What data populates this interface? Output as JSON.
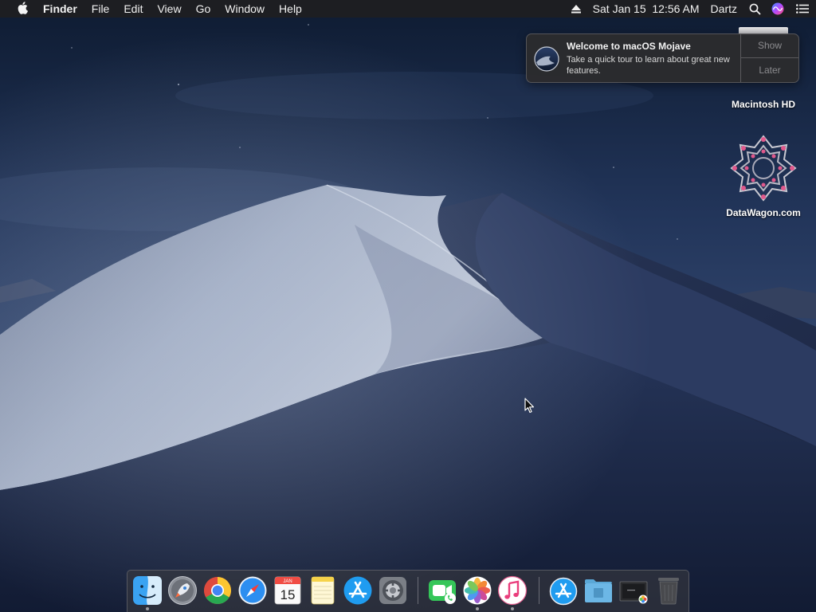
{
  "menubar": {
    "apple_icon": "apple-logo-icon",
    "app_name": "Finder",
    "menus": [
      "File",
      "Edit",
      "View",
      "Go",
      "Window",
      "Help"
    ],
    "status": {
      "eject_icon": "eject-icon",
      "clock": "Sat Jan 15  12:56 AM",
      "user": "Dartz",
      "spotlight_icon": "search-icon",
      "siri_icon": "siri-icon",
      "notification_center_icon": "list-icon"
    }
  },
  "notification": {
    "title": "Welcome to macOS Mojave",
    "body": "Take a quick tour to learn about great new features.",
    "show_label": "Show",
    "later_label": "Later"
  },
  "desktop_icons": [
    {
      "label": "Macintosh HD",
      "icon": "hard-drive-icon"
    },
    {
      "label": "DataWagon.com",
      "icon": "datawagon-logo-icon"
    }
  ],
  "dock": {
    "calendar_month": "JAN",
    "calendar_day": "15",
    "apps": [
      {
        "name": "Finder",
        "icon": "finder-icon",
        "running": true
      },
      {
        "name": "Launchpad",
        "icon": "launchpad-icon",
        "running": false
      },
      {
        "name": "Google Chrome",
        "icon": "chrome-icon",
        "running": false
      },
      {
        "name": "Safari",
        "icon": "safari-icon",
        "running": false
      },
      {
        "name": "Calendar",
        "icon": "calendar-icon",
        "running": false
      },
      {
        "name": "Notes",
        "icon": "notes-icon",
        "running": false
      },
      {
        "name": "App Store",
        "icon": "app-store-icon",
        "running": false
      },
      {
        "name": "System Preferences",
        "icon": "system-preferences-icon",
        "running": false
      },
      {
        "name": "FaceTime",
        "icon": "facetime-icon",
        "running": false
      },
      {
        "name": "Photos",
        "icon": "photos-icon",
        "running": true
      },
      {
        "name": "iTunes",
        "icon": "itunes-icon",
        "running": true
      },
      {
        "name": "Applications",
        "icon": "applications-folder-icon",
        "running": false
      },
      {
        "name": "Documents",
        "icon": "documents-folder-icon",
        "running": false
      },
      {
        "name": "Recent Items",
        "icon": "recent-items-stack-icon",
        "running": false
      },
      {
        "name": "Trash",
        "icon": "trash-icon",
        "running": false
      }
    ]
  },
  "colors": {
    "sky_top": "#0f1d33",
    "sky_mid": "#27395a",
    "dune_light": "#9ba7bd",
    "dune_shadow": "#1e2a46",
    "menubar": "#1e1e21",
    "notification_bg": "#2c2c2e"
  }
}
